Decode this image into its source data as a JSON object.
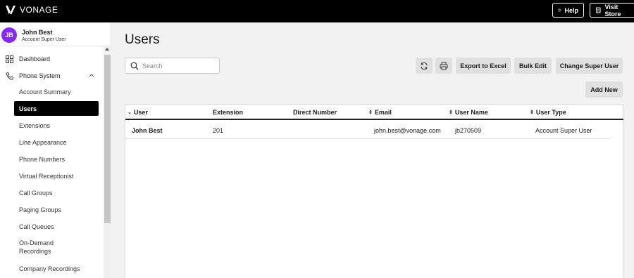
{
  "topbar": {
    "brand": "VONAGE",
    "help_label": "Help",
    "store_label": "Visit Store"
  },
  "user": {
    "initials": "JB",
    "name": "John Best",
    "role": "Account Super User"
  },
  "sidebar": {
    "dashboard": "Dashboard",
    "phone_system": "Phone System",
    "items": [
      "Account Summary",
      "Users",
      "Extensions",
      "Line Appearance",
      "Phone Numbers",
      "Virtual Receptionist",
      "Call Groups",
      "Paging Groups",
      "Call Queues",
      "On-Demand Recordings",
      "Company Recordings"
    ],
    "active_item": "Users"
  },
  "main": {
    "title": "Users",
    "search_placeholder": "Search",
    "export_label": "Export to Excel",
    "bulk_edit_label": "Bulk Edit",
    "change_super_label": "Change Super User",
    "add_new_label": "Add New"
  },
  "table": {
    "columns": [
      "User",
      "Extension",
      "Direct Number",
      "Email",
      "User Name",
      "User Type"
    ],
    "rows": [
      {
        "user": "John Best",
        "extension": "201",
        "direct_number": "",
        "email": "john.best@vonage.com",
        "user_name": "jb270509",
        "user_type": "Account Super User"
      }
    ]
  },
  "colors": {
    "topbar": "#000000",
    "avatar": "#8728fb",
    "active_nav": "#000000"
  }
}
